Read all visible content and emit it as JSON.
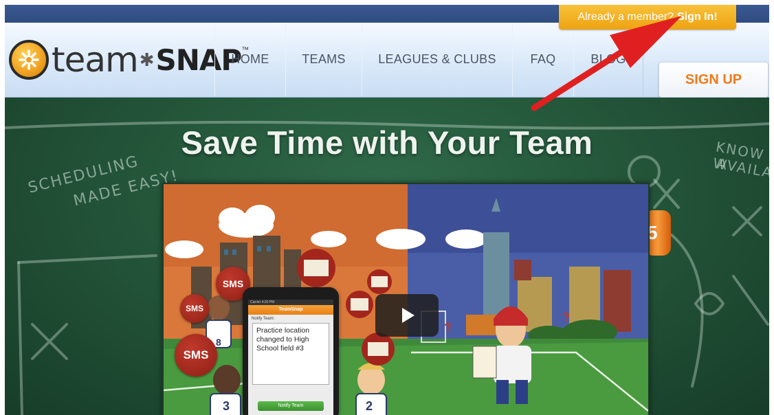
{
  "header": {
    "logo": {
      "team": "team",
      "snap": "SNAP",
      "tm": "™"
    },
    "nav": [
      {
        "label": "HOME"
      },
      {
        "label": "TEAMS"
      },
      {
        "label": "LEAGUES & CLUBS"
      },
      {
        "label": "FAQ"
      },
      {
        "label": "BLOG"
      }
    ],
    "signup_label": "SIGN UP",
    "member": {
      "text": "Already a member?",
      "link": "Sign In!"
    }
  },
  "hero": {
    "title": "Save Time with Your Team",
    "chalk_notes": [
      "SCHEDULING",
      "MADE EASY!",
      "KNOW W",
      "AVAILAE"
    ],
    "video": {
      "sms_label": "SMS",
      "phone": {
        "status": "Carrier   4:20 PM",
        "app_name": "TeamSnap",
        "notify_label": "Notify Team:",
        "message": "Practice location changed to High School field #3",
        "button": "Notify Team"
      },
      "jersey_numbers": [
        "8",
        "3",
        "2"
      ]
    }
  },
  "colors": {
    "accent_orange": "#f07a1a",
    "member_tab": "#f5b52a",
    "chalkboard": "#24563a",
    "annotation_arrow": "#e02020"
  }
}
